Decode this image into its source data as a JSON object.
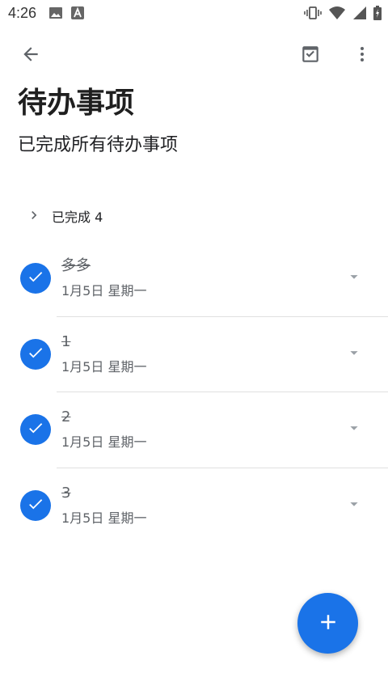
{
  "status_bar": {
    "time": "4:26",
    "left_icons": [
      "image-icon",
      "app-a-icon"
    ],
    "right_icons": [
      "vibrate-icon",
      "wifi-icon",
      "signal-icon",
      "battery-icon"
    ]
  },
  "app_bar": {
    "back_icon": "arrow-back-icon",
    "done_icon": "task-done-icon",
    "more_icon": "more-vert-icon"
  },
  "header": {
    "title": "待办事项",
    "subtitle": "已完成所有待办事项"
  },
  "completed_section": {
    "label": "已完成 4"
  },
  "tasks": [
    {
      "title": "多多",
      "date": "1月5日 星期一"
    },
    {
      "title": "1",
      "date": "1月5日 星期一"
    },
    {
      "title": "2",
      "date": "1月5日 星期一"
    },
    {
      "title": "3",
      "date": "1月5日 星期一"
    }
  ],
  "colors": {
    "accent": "#1a73e8",
    "text_primary": "#202124",
    "text_secondary": "#5f6368",
    "divider": "#e0e0e0"
  }
}
